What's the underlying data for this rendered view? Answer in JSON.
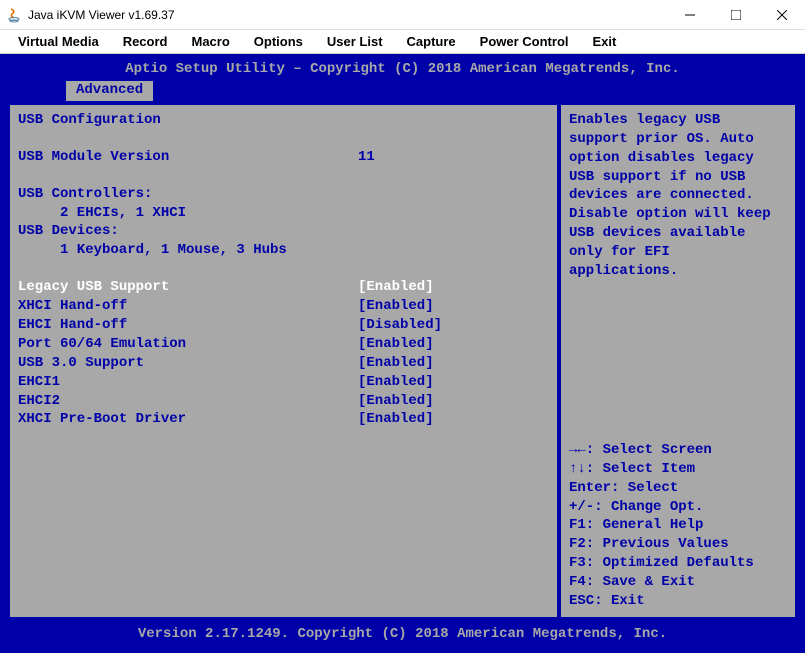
{
  "window": {
    "title": "Java iKVM Viewer v1.69.37"
  },
  "menubar": {
    "items": [
      "Virtual Media",
      "Record",
      "Macro",
      "Options",
      "User List",
      "Capture",
      "Power Control",
      "Exit"
    ]
  },
  "bios": {
    "header": "Aptio Setup Utility – Copyright (C) 2018 American Megatrends, Inc.",
    "tab": "Advanced",
    "footer": "Version 2.17.1249. Copyright (C) 2018 American Megatrends, Inc.",
    "section_title": "USB Configuration",
    "module_version_label": "USB Module Version",
    "module_version_value": "11",
    "controllers_label": "USB Controllers:",
    "controllers_value": "2 EHCIs, 1 XHCI",
    "devices_label": "USB Devices:",
    "devices_value": "1 Keyboard, 1 Mouse, 3 Hubs",
    "settings": [
      {
        "label": "Legacy USB Support",
        "value": "[Enabled]",
        "selected": true
      },
      {
        "label": "XHCI Hand-off",
        "value": "[Enabled]",
        "selected": false
      },
      {
        "label": "EHCI Hand-off",
        "value": "[Disabled]",
        "selected": false
      },
      {
        "label": "Port 60/64 Emulation",
        "value": "[Enabled]",
        "selected": false
      },
      {
        "label": "USB 3.0 Support",
        "value": "[Enabled]",
        "selected": false
      },
      {
        "label": "EHCI1",
        "value": "[Enabled]",
        "selected": false
      },
      {
        "label": "EHCI2",
        "value": "[Enabled]",
        "selected": false
      },
      {
        "label": "XHCI Pre-Boot Driver",
        "value": "[Enabled]",
        "selected": false
      }
    ],
    "help_text": "Enables legacy USB support prior OS. Auto option disables legacy USB support if no USB devices are connected. Disable option will keep USB devices available only for EFI applications.",
    "key_hints": [
      "→←: Select Screen",
      "↑↓: Select Item",
      "Enter: Select",
      "+/-: Change Opt.",
      "F1: General Help",
      "F2: Previous Values",
      "F3: Optimized Defaults",
      "F4: Save & Exit",
      "ESC: Exit"
    ]
  }
}
